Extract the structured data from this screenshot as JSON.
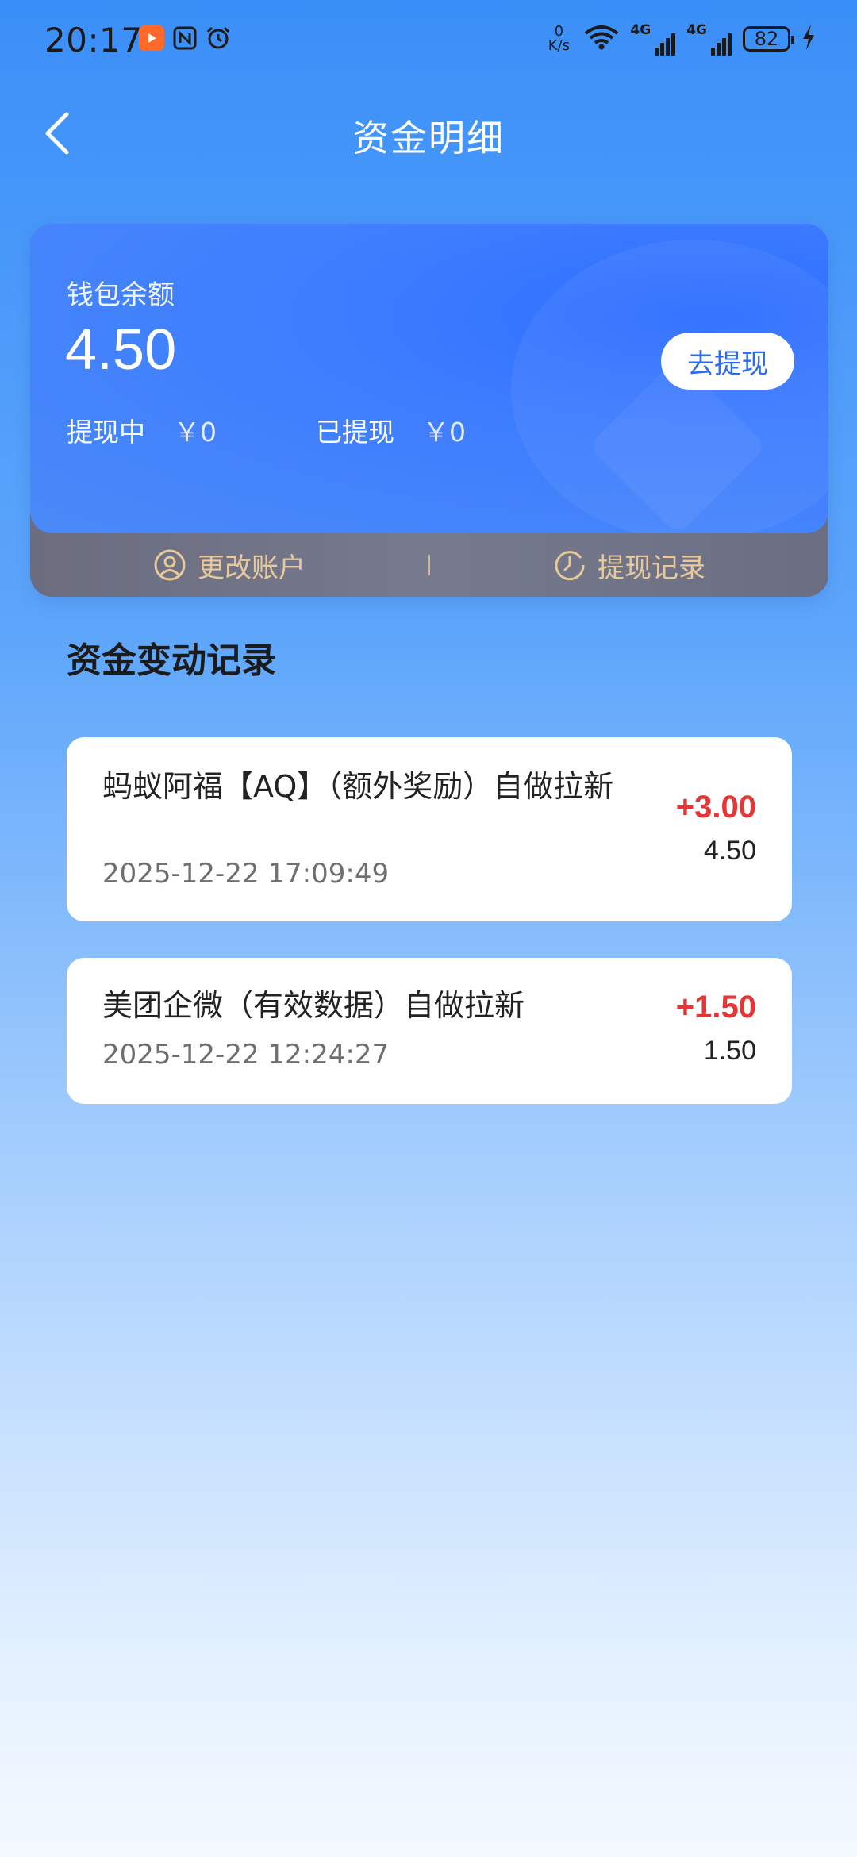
{
  "status_bar": {
    "time": "20:17",
    "net_speed_value": "0",
    "net_speed_unit": "K/s",
    "signal_label_1": "4G",
    "signal_label_2": "4G",
    "battery": "82"
  },
  "header": {
    "title": "资金明细"
  },
  "wallet": {
    "balance_label": "钱包余额",
    "balance_value": "4.50",
    "withdraw_button": "去提现",
    "pending_label": "提现中",
    "pending_value": "￥0",
    "withdrawn_label": "已提现",
    "withdrawn_value": "￥0",
    "change_account": "更改账户",
    "divider": "|",
    "withdraw_records": "提现记录"
  },
  "section": {
    "title": "资金变动记录"
  },
  "records": [
    {
      "title": "蚂蚁阿福【AQ】（额外奖励）自做拉新",
      "date": "2025-12-22 17:09:49",
      "amount": "+3.00",
      "balance": "4.50"
    },
    {
      "title": "美团企微（有效数据）自做拉新",
      "date": "2025-12-22 12:24:27",
      "amount": "+1.50",
      "balance": "1.50"
    }
  ],
  "colors": {
    "accent_blue": "#2b6af2",
    "amount_red": "#e63535",
    "gold_text": "#e8c99a"
  }
}
